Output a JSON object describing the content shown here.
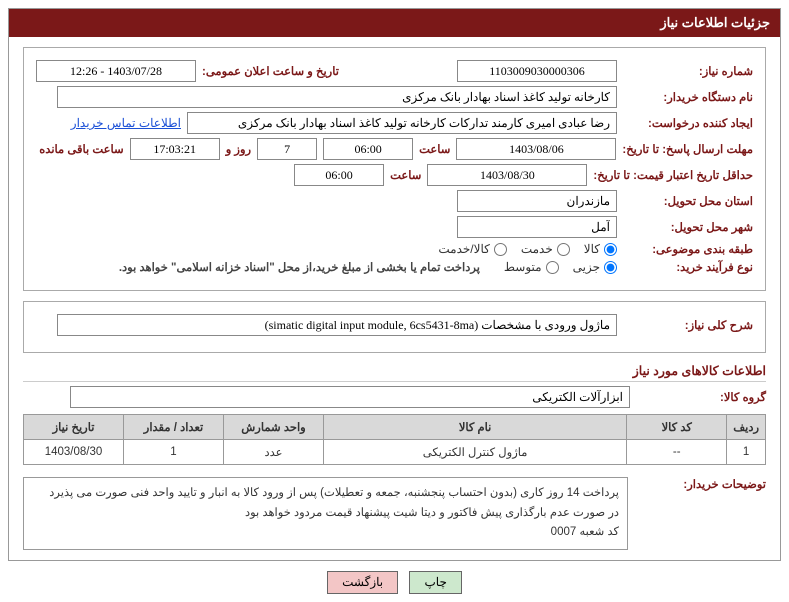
{
  "header": {
    "title": "جزئیات اطلاعات نیاز"
  },
  "fields": {
    "need_no_label": "شماره نیاز:",
    "need_no": "1103009030000306",
    "publish_label": "تاریخ و ساعت اعلان عمومی:",
    "publish_value": "1403/07/28 - 12:26",
    "buyer_label": "نام دستگاه خریدار:",
    "buyer_value": "کارخانه تولید کاغذ اسناد بهادار بانک مرکزی",
    "requester_label": "ایجاد کننده درخواست:",
    "requester_value": "رضا عبادی امیری کارمند تدارکات کارخانه تولید کاغذ اسناد بهادار بانک مرکزی",
    "contact_link": "اطلاعات تماس خریدار",
    "deadline_label": "مهلت ارسال پاسخ: تا تاریخ:",
    "deadline_date": "1403/08/06",
    "deadline_time_label": "ساعت",
    "deadline_time": "06:00",
    "days_val": "7",
    "days_and": "روز و",
    "timer": "17:03:21",
    "remaining": "ساعت باقی مانده",
    "min_validity_label": "حداقل تاریخ اعتبار قیمت: تا تاریخ:",
    "min_validity_date": "1403/08/30",
    "min_validity_time": "06:00",
    "province_label": "استان محل تحویل:",
    "province_value": "مازندران",
    "city_label": "شهر محل تحویل:",
    "city_value": "آمل",
    "category_label": "طبقه بندی موضوعی:",
    "process_label": "نوع فرآیند خرید:",
    "islamic_note": "پرداخت تمام یا بخشی از مبلغ خرید،از محل \"اسناد خزانه اسلامی\" خواهد بود."
  },
  "radios": {
    "cat": {
      "kala": "کالا",
      "khedmat": "خدمت",
      "both": "کالا/خدمت"
    },
    "proc": {
      "jozee": "جزیی",
      "motavasset": "متوسط"
    }
  },
  "overview": {
    "label": "شرح کلی نیاز:",
    "value": "ماژول ورودی با مشخصات (simatic digital input module, 6cs5431-8ma)"
  },
  "goods_section": {
    "title": "اطلاعات کالاهای مورد نیاز",
    "group_label": "گروه کالا:",
    "group_value": "ابزارآلات الکتریکی"
  },
  "table": {
    "headers": {
      "row": "ردیف",
      "code": "کد کالا",
      "name": "نام کالا",
      "unit": "واحد شمارش",
      "qty": "تعداد / مقدار",
      "date": "تاریخ نیاز"
    },
    "rows": [
      {
        "row": "1",
        "code": "--",
        "name": "ماژول کنترل الکتریکی",
        "unit": "عدد",
        "qty": "1",
        "date": "1403/08/30"
      }
    ]
  },
  "buyer_notes": {
    "label": "توضیحات خریدار:",
    "line1": "پرداخت 14 روز کاری (بدون احتساب پنجشنبه، جمعه و تعطیلات) پس از ورود کالا به انبار و تایید واحد فنی صورت می پذیرد",
    "line2": "در صورت عدم بارگذاری پیش فاکتور و دیتا شیت پیشنهاد قیمت مردود خواهد بود",
    "line3": "کد شعبه 0007"
  },
  "buttons": {
    "print": "چاپ",
    "back": "بازگشت"
  }
}
